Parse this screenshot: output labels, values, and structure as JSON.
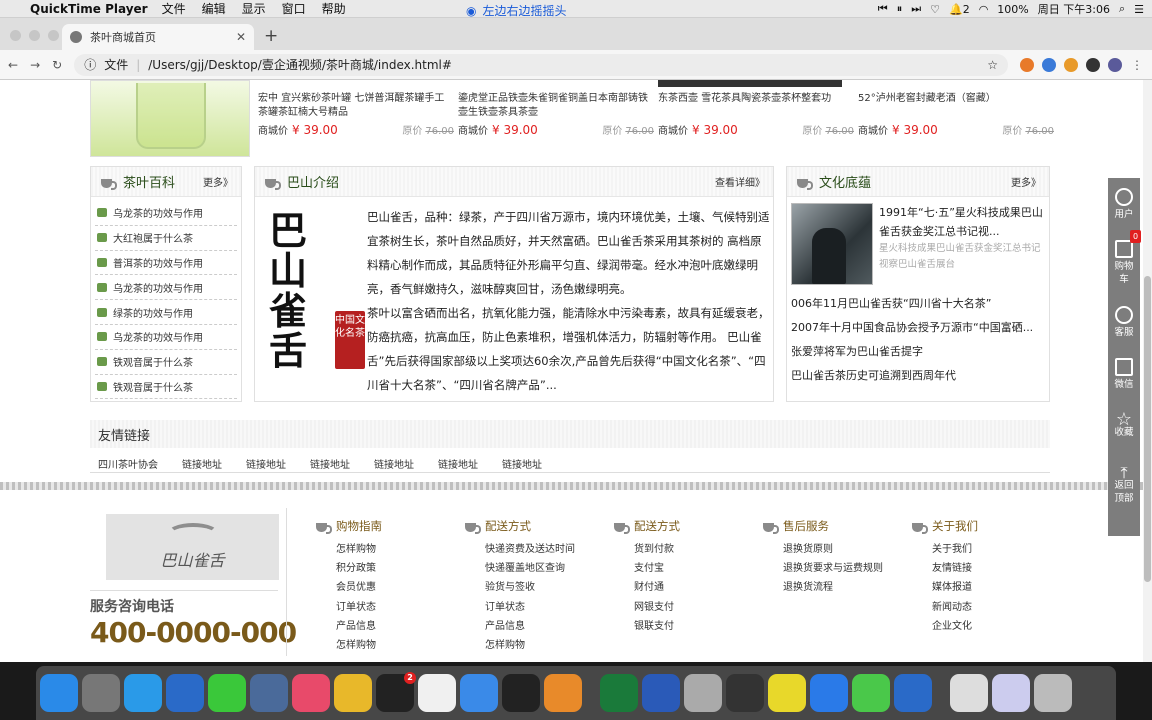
{
  "menubar": {
    "app_name": "QuickTime Player",
    "items": [
      "文件",
      "编辑",
      "显示",
      "窗口",
      "帮助"
    ],
    "center_text": "左边右边摇摇头",
    "battery": "100%",
    "notif_count": "2",
    "datetime": "周日 下午3:06"
  },
  "browser": {
    "tab_title": "茶叶商城首页",
    "url_scheme": "文件",
    "url": "/Users/gjj/Desktop/壹企通视频/茶叶商城/index.html#"
  },
  "products": [
    {
      "name": "宏中 宜兴紫砂茶叶罐 七饼普洱醒茶罐手工茶罐茶缸楠大号精品",
      "mall_label": "商城价",
      "price": "¥ 39.00",
      "orig_label": "原价",
      "orig": "76.00"
    },
    {
      "name": "鎏虎堂正品铁壶朱雀铜雀铜盖日本南部铸铁壶生铁壶茶具茶壶",
      "mall_label": "商城价",
      "price": "¥ 39.00",
      "orig_label": "原价",
      "orig": "76.00"
    },
    {
      "name": "东茶西壶 雪花茶具陶瓷茶壶茶杯整套功",
      "mall_label": "商城价",
      "price": "¥ 39.00",
      "orig_label": "原价",
      "orig": "76.00"
    },
    {
      "name": "52°泸州老窖封藏老酒（窖藏）",
      "mall_label": "商城价",
      "price": "¥ 39.00",
      "orig_label": "原价",
      "orig": "76.00"
    }
  ],
  "wiki": {
    "title": "茶叶百科",
    "more": "更多》",
    "items": [
      "乌龙茶的功效与作用",
      "大红袍属于什么茶",
      "普洱茶的功效与作用",
      "乌龙茶的功效与作用",
      "绿茶的功效与作用",
      "乌龙茶的功效与作用",
      "铁观音属于什么茶",
      "铁观音属于什么茶"
    ]
  },
  "intro": {
    "title": "巴山介绍",
    "more": "查看详细》",
    "logo_chars": [
      "巴",
      "山",
      "雀",
      "舌"
    ],
    "seal": "中国文化名茶",
    "p1": "巴山雀舌，品种：绿茶，产于四川省万源市，境内环境优美，土壤、气候特别适宜茶树生长，茶叶自然品质好，并天然富硒。巴山雀舌茶采用其茶树的 高档原料精心制作而成，其品质特征外形扁平匀直、绿润带毫。经水冲泡叶底嫩绿明亮，香气鲜嫩持久，滋味醇爽回甘，汤色嫩绿明亮。",
    "p2": "茶叶以富含硒而出名，抗氧化能力强，能清除水中污染毒素，故具有延缓衰老，防癌抗癌，抗高血压，防止色素堆积，增强机体活力，防辐射等作用。 巴山雀舌”先后获得国家部级以上奖项达60余次,产品曾先后获得“中国文化名茶”、“四川省十大名茶”、“四川省名牌产品”..."
  },
  "culture": {
    "title": "文化底蕴",
    "more": "更多》",
    "lead": "1991年“七·五”星火科技成果巴山雀舌获金奖江总书记视...",
    "sub": "星火科技成果巴山雀舌获金奖江总书记视察巴山雀舌展台",
    "news": [
      "006年11月巴山雀舌获“四川省十大名茶”",
      "2007年十月中国食品协会授予万源市“中国富硒...",
      "张爱萍将军为巴山雀舌提字",
      "巴山雀舌茶历史可追溯到西周年代"
    ]
  },
  "links": {
    "title": "友情链接",
    "items": [
      "四川茶叶协会",
      "链接地址",
      "链接地址",
      "链接地址",
      "链接地址",
      "链接地址",
      "链接地址"
    ]
  },
  "footer": {
    "logo_text": "巴山雀舌",
    "hotline_label": "服务咨询电话",
    "hotline": "400-0000-000",
    "cols": [
      {
        "title": "购物指南",
        "items": [
          "怎样购物",
          "积分政策",
          "会员优惠",
          "订单状态",
          "产品信息",
          "怎样购物"
        ]
      },
      {
        "title": "配送方式",
        "items": [
          "快递资费及送达时间",
          "快递覆盖地区查询",
          "验货与签收",
          "订单状态",
          "产品信息",
          "怎样购物"
        ]
      },
      {
        "title": "配送方式",
        "items": [
          "货到付款",
          "支付宝",
          "财付通",
          "网银支付",
          "银联支付"
        ]
      },
      {
        "title": "售后服务",
        "items": [
          "退换货原则",
          "退换货要求与运费规则",
          "退换货流程"
        ]
      },
      {
        "title": "关于我们",
        "items": [
          "关于我们",
          "友情链接",
          "媒体报道",
          "新闻动态",
          "企业文化"
        ]
      }
    ]
  },
  "sidebar": {
    "user": "用户",
    "cart": "购物车",
    "cart_count": "0",
    "service": "客服",
    "wechat": "微信",
    "favorite": "收藏",
    "top": "返回顶部"
  },
  "dock": {
    "apps": [
      "finder",
      "launchpad",
      "safari",
      "quicktime",
      "wechat",
      "unknown",
      "music",
      "chrome",
      "qq",
      "vscode",
      "feishu",
      "terminal",
      "sublime",
      "excel",
      "word",
      "preview",
      "code",
      "qqmusic",
      "maps",
      "wechat-work",
      "quicktime2",
      "finder-window",
      "preview2",
      "trash"
    ],
    "qq_badge": "2"
  },
  "colors": {
    "accent_red": "#e02020",
    "tea_green": "#2a4d1a",
    "brown": "#7a5a1a"
  }
}
